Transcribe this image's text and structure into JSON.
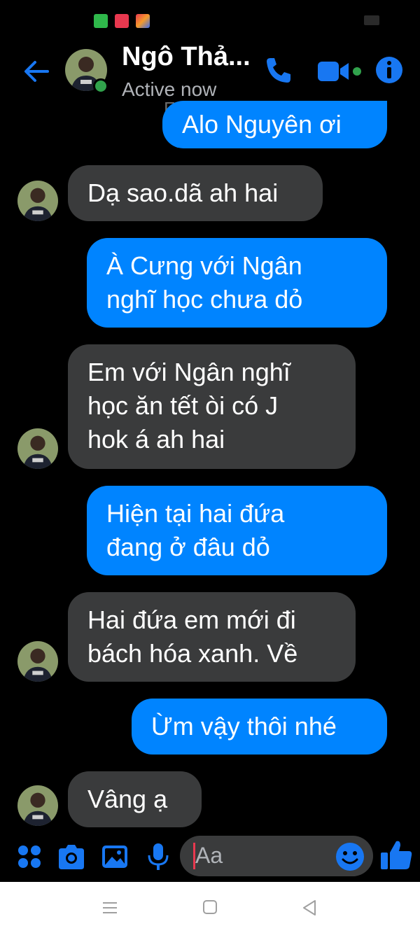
{
  "header": {
    "contact_name": "Ngô Thả...",
    "status": "Active now",
    "watermark": "FakeChat"
  },
  "messages": [
    {
      "from": "me",
      "text": "Alo Nguyên ơi"
    },
    {
      "from": "them",
      "text": "Dạ sao.dã ah hai"
    },
    {
      "from": "me",
      "text": "À Cưng với Ngân\nnghĩ học chưa dỏ"
    },
    {
      "from": "them",
      "text": "Em với Ngân nghĩ\nhọc ăn tết òi có J\nhok á ah hai"
    },
    {
      "from": "me",
      "text": "Hiện tại hai đứa\nđang ở đâu dỏ"
    },
    {
      "from": "them",
      "text": "Hai đứa em mới đi\nbách hóa xanh. Về"
    },
    {
      "from": "me",
      "text": "Ừm vậy thôi nhé"
    },
    {
      "from": "them",
      "text": "Vâng ạ"
    }
  ],
  "composer": {
    "placeholder": "Aa"
  },
  "colors": {
    "outgoing_bubble": "#0084ff",
    "incoming_bubble": "#3a3b3c",
    "accent": "#1877f2",
    "online": "#31a24c",
    "background": "#000000"
  },
  "icons": {
    "back": "arrow-left-icon",
    "call": "phone-icon",
    "video": "video-camera-icon",
    "info": "info-icon",
    "menu": "four-dots-icon",
    "camera": "camera-icon",
    "gallery": "image-icon",
    "mic": "microphone-icon",
    "emoji": "smiley-icon",
    "like": "thumbs-up-icon"
  }
}
